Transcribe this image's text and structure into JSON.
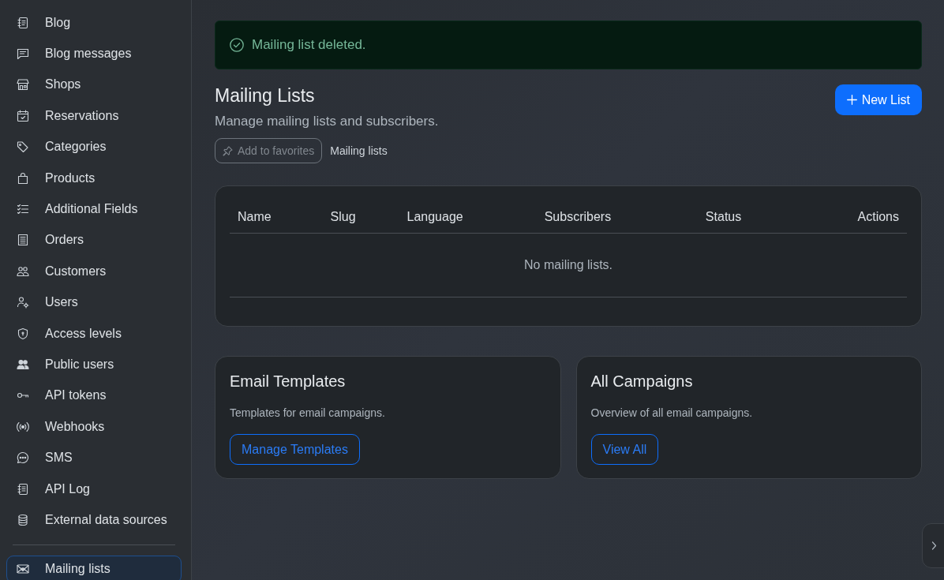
{
  "sidebar": {
    "groups": [
      {
        "items": [
          {
            "label": "Blog",
            "selected": false
          },
          {
            "label": "Blog messages",
            "selected": false
          },
          {
            "label": "Shops",
            "selected": false
          },
          {
            "label": "Reservations",
            "selected": false
          },
          {
            "label": "Categories",
            "selected": false
          },
          {
            "label": "Products",
            "selected": false
          },
          {
            "label": "Additional Fields",
            "selected": false
          },
          {
            "label": "Orders",
            "selected": false
          },
          {
            "label": "Customers",
            "selected": false
          },
          {
            "label": "Users",
            "selected": false
          },
          {
            "label": "Access levels",
            "selected": false
          },
          {
            "label": "Public users",
            "selected": false
          },
          {
            "label": "API tokens",
            "selected": false
          },
          {
            "label": "Webhooks",
            "selected": false
          },
          {
            "label": "SMS",
            "selected": false
          },
          {
            "label": "API Log",
            "selected": false
          },
          {
            "label": "External data sources",
            "selected": false
          }
        ]
      },
      {
        "items": [
          {
            "label": "Mailing lists",
            "selected": true
          }
        ]
      }
    ]
  },
  "alert": {
    "kind": "success",
    "message": "Mailing list deleted."
  },
  "page_header": {
    "title": "Mailing Lists",
    "subtitle": "Manage mailing lists and subscribers.",
    "favorite_button": "Add to favorites",
    "breadcrumb": "Mailing lists",
    "primary_button": "New List"
  },
  "table": {
    "columns": [
      "Name",
      "Slug",
      "Language",
      "Subscribers",
      "Status",
      "Actions"
    ],
    "empty_message": "No mailing lists."
  },
  "cards": [
    {
      "title": "Email Templates",
      "description": "Templates for email campaigns.",
      "button": "Manage Templates"
    },
    {
      "title": "All Campaigns",
      "description": "Overview of all email campaigns.",
      "button": "View All"
    }
  ]
}
